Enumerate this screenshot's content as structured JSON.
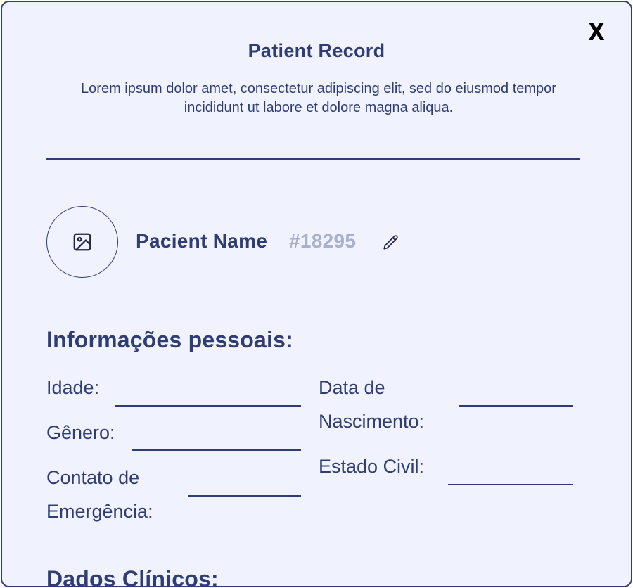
{
  "modal": {
    "close_label": "X",
    "title": "Patient Record",
    "subtitle": "Lorem ipsum dolor   amet, consectetur adipiscing elit, sed do eiusmod tempor incididunt ut labore et dolore magna aliqua."
  },
  "patient": {
    "name": "Pacient Name",
    "id": "#18295",
    "avatar_icon": "image-icon",
    "edit_icon": "pencil-icon"
  },
  "personal_info": {
    "title": "Informações pessoais:",
    "idade_label": "Idade:",
    "idade_value": "",
    "genero_label": "Gênero:",
    "genero_value": "",
    "contato_label_line1": "Contato de",
    "contato_label_line2": "Emergência:",
    "contato_value": "",
    "nascimento_label_line1": "Data de",
    "nascimento_label_line2": "Nascimento:",
    "nascimento_value": "",
    "estado_civil_label": "Estado Civil:",
    "estado_civil_value": ""
  },
  "clinical": {
    "title": "Dados Clínicos:"
  },
  "colors": {
    "primary": "#2f3d74",
    "background": "#f0f3fd",
    "muted": "#a9b0cd"
  }
}
